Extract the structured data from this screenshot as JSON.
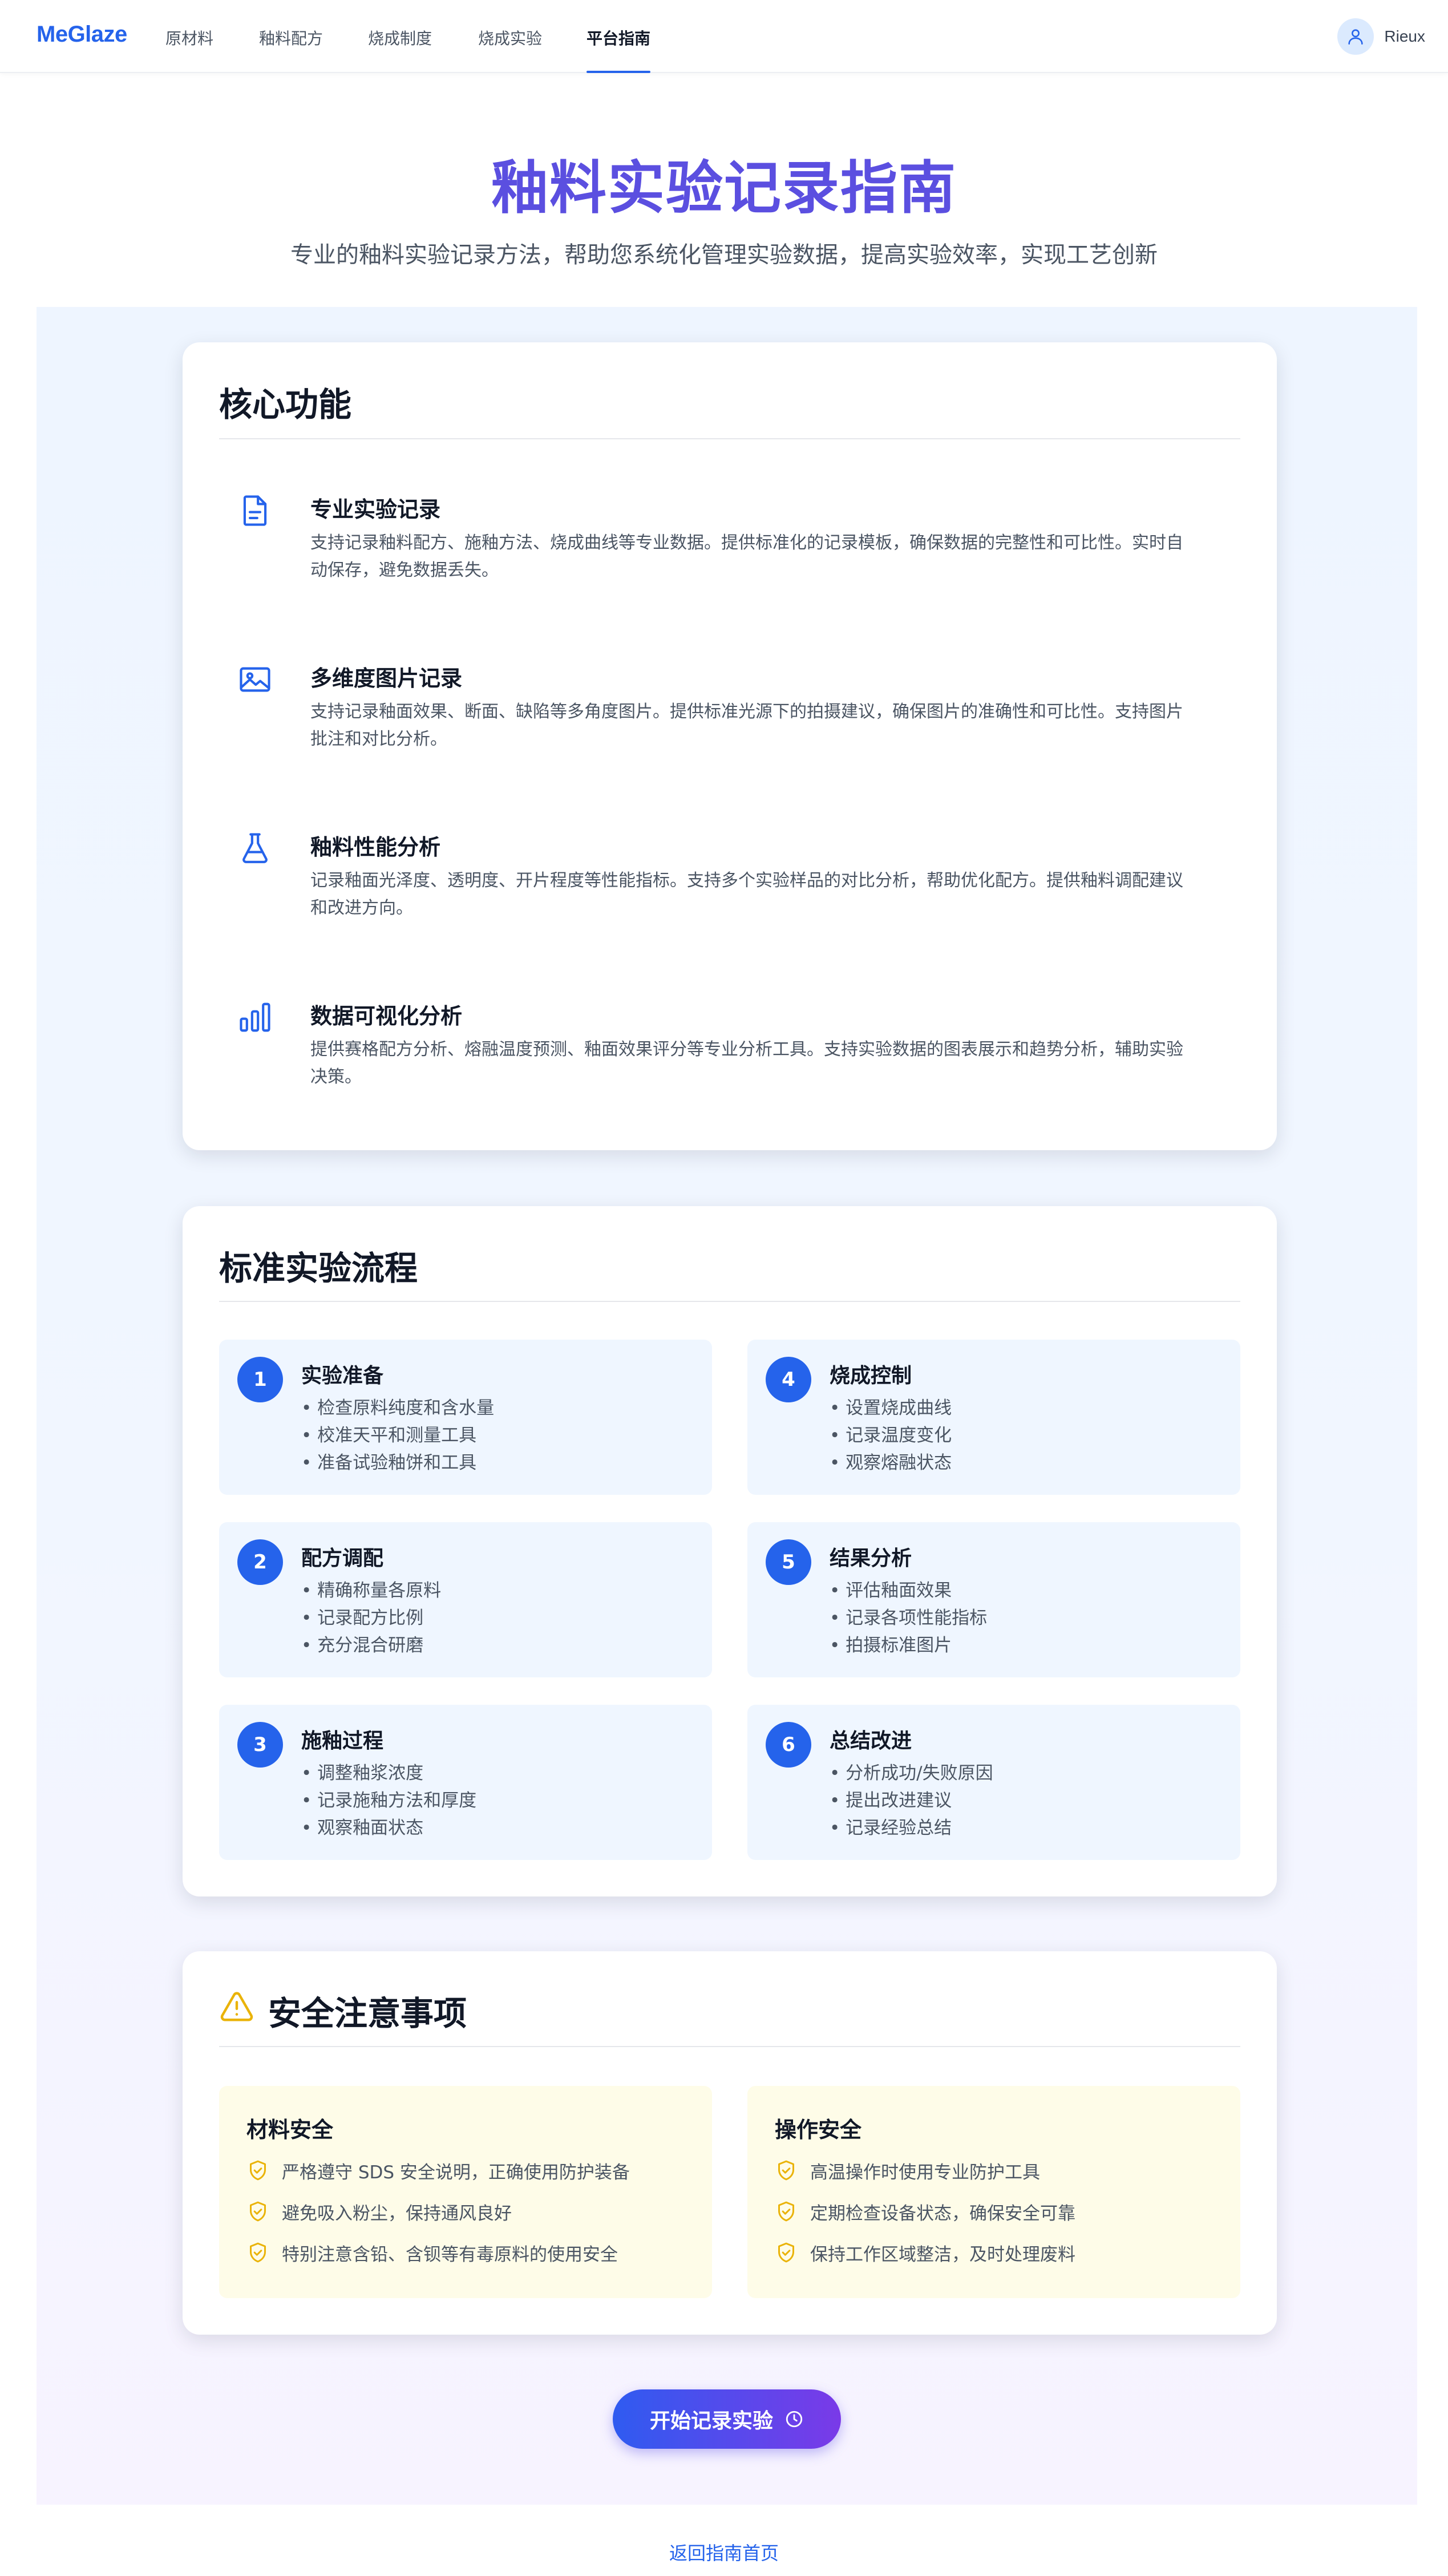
{
  "nav": {
    "brand": "MeGlaze",
    "items": [
      "原材料",
      "釉料配方",
      "烧成制度",
      "烧成实验",
      "平台指南"
    ],
    "active": "平台指南",
    "user": "Rieux"
  },
  "hero": {
    "title": "釉料实验记录指南",
    "subtitle": "专业的釉料实验记录方法，帮助您系统化管理实验数据，提高实验效率，实现工艺创新"
  },
  "core": {
    "title": "核心功能",
    "features": [
      {
        "icon": "document-icon",
        "title": "专业实验记录",
        "lines": [
          "支持记录釉料配方、施釉方法、烧成曲线等专业数据。提供标准化的记录模板，确保数据的完整性和可比性。实时自",
          "动保存，避免数据丢失。"
        ]
      },
      {
        "icon": "image-icon",
        "title": "多维度图片记录",
        "lines": [
          "支持记录釉面效果、断面、缺陷等多角度图片。提供标准光源下的拍摄建议，确保图片的准确性和可比性。支持图片",
          "批注和对比分析。"
        ]
      },
      {
        "icon": "flask-icon",
        "title": "釉料性能分析",
        "lines": [
          "记录釉面光泽度、透明度、开片程度等性能指标。支持多个实验样品的对比分析，帮助优化配方。提供釉料调配建议",
          "和改进方向。"
        ]
      },
      {
        "icon": "bar-chart-icon",
        "title": "数据可视化分析",
        "lines": [
          "提供赛格配方分析、熔融温度预测、釉面效果评分等专业分析工具。支持实验数据的图表展示和趋势分析，辅助实验",
          "决策。"
        ]
      }
    ]
  },
  "process": {
    "title": "标准实验流程",
    "steps": [
      {
        "num": "1",
        "title": "实验准备",
        "items": [
          "检查原料纯度和含水量",
          "校准天平和测量工具",
          "准备试验釉饼和工具"
        ]
      },
      {
        "num": "4",
        "title": "烧成控制",
        "items": [
          "设置烧成曲线",
          "记录温度变化",
          "观察熔融状态"
        ]
      },
      {
        "num": "2",
        "title": "配方调配",
        "items": [
          "精确称量各原料",
          "记录配方比例",
          "充分混合研磨"
        ]
      },
      {
        "num": "5",
        "title": "结果分析",
        "items": [
          "评估釉面效果",
          "记录各项性能指标",
          "拍摄标准图片"
        ]
      },
      {
        "num": "3",
        "title": "施釉过程",
        "items": [
          "调整釉浆浓度",
          "记录施釉方法和厚度",
          "观察釉面状态"
        ]
      },
      {
        "num": "6",
        "title": "总结改进",
        "items": [
          "分析成功/失败原因",
          "提出改进建议",
          "记录经验总结"
        ]
      }
    ]
  },
  "safety": {
    "title": "安全注意事项",
    "groups": [
      {
        "title": "材料安全",
        "items": [
          "严格遵守 SDS 安全说明，正确使用防护装备",
          "避免吸入粉尘，保持通风良好",
          "特别注意含铅、含钡等有毒原料的使用安全"
        ]
      },
      {
        "title": "操作安全",
        "items": [
          "高温操作时使用专业防护工具",
          "定期检查设备状态，确保安全可靠",
          "保持工作区域整洁，及时处理废料"
        ]
      }
    ]
  },
  "cta": {
    "label": "开始记录实验"
  },
  "footer": {
    "back": "返回指南首页"
  },
  "colors": {
    "brand": "#2563eb",
    "title": "#5b4fe0",
    "step_bg": "#eff6ff",
    "safe_bg": "#fefce8",
    "warn": "#eab308"
  }
}
